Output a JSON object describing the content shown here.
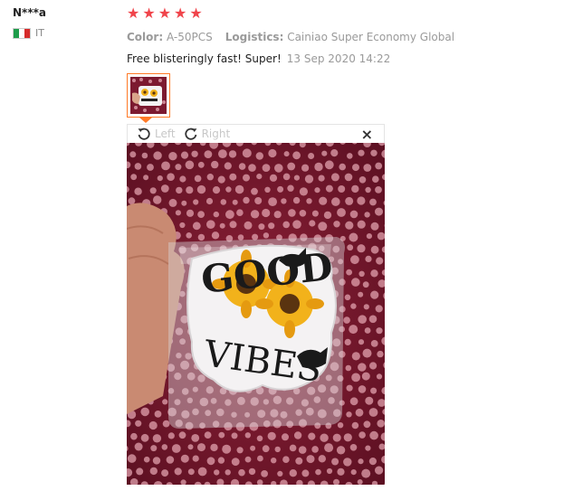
{
  "reviewer": {
    "name": "N***a",
    "country_code": "IT",
    "flag_colors": [
      "#1e9c4a",
      "#ffffff",
      "#d62b2b"
    ]
  },
  "review": {
    "rating": 5,
    "rating_max": 5,
    "star_color": "#f0444b",
    "color_label": "Color:",
    "color_value": "A-50PCS",
    "logistics_label": "Logistics:",
    "logistics_value": "Cainiao Super Economy Global",
    "text": "Free blisteringly fast! Super!",
    "date": "13 Sep 2020 14:22"
  },
  "viewer": {
    "rotate_left_label": "Left",
    "rotate_right_label": "Right",
    "close_symbol": "×",
    "accent_color": "#ff7a27",
    "photo_caption": [
      "GOOD",
      "VIBES"
    ]
  }
}
